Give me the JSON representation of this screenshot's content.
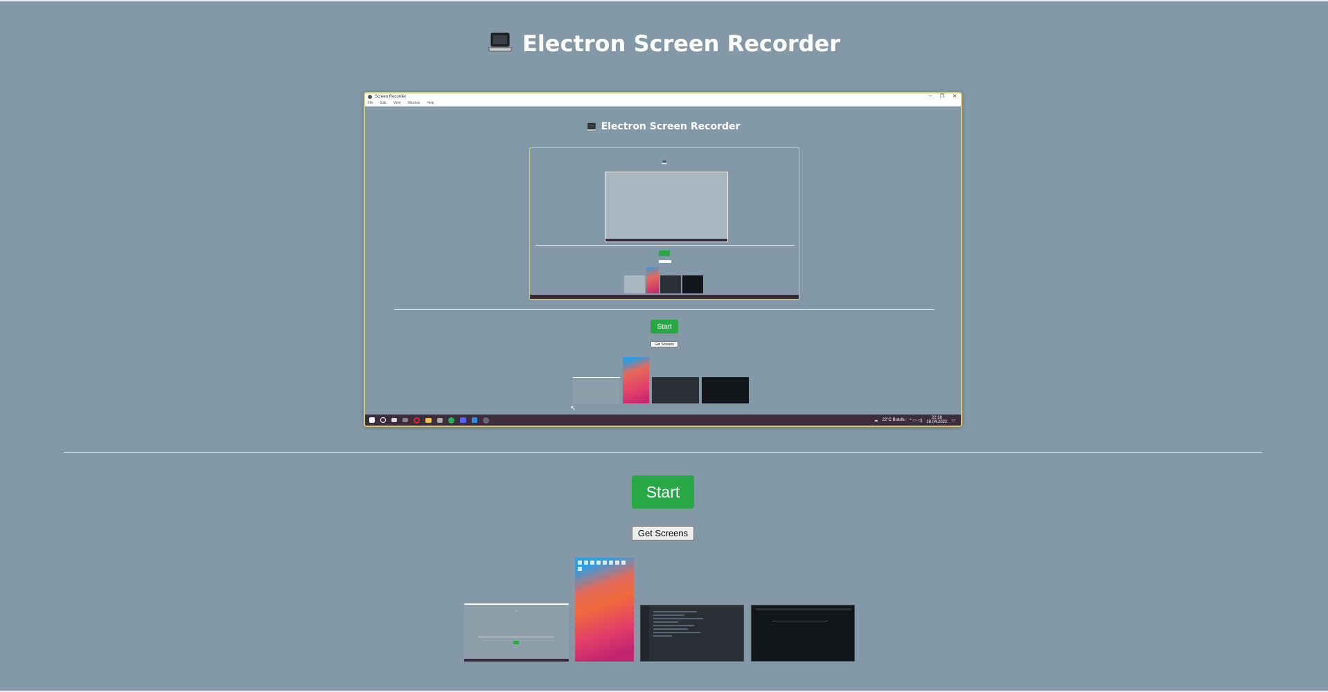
{
  "app": {
    "title": "Electron Screen Recorder",
    "title_icon": "laptop-icon"
  },
  "preview": {
    "window_title": "Screen Recorder",
    "window_controls": [
      "–",
      "❐",
      "✕"
    ],
    "menu": [
      "File",
      "Edit",
      "View",
      "Window",
      "Help"
    ],
    "inner_title": "Electron Screen Recorder",
    "start_label": "Start",
    "get_screens_label": "Get Screens",
    "taskbar": {
      "weather": "22°C Bulutlu",
      "time": "22:18",
      "date": "18.04.2022"
    }
  },
  "controls": {
    "start_label": "Start",
    "get_screens_label": "Get Screens"
  },
  "colors": {
    "background": "#8399a7",
    "start_button": "#28a745",
    "taskbar": "#3d2c3c"
  }
}
